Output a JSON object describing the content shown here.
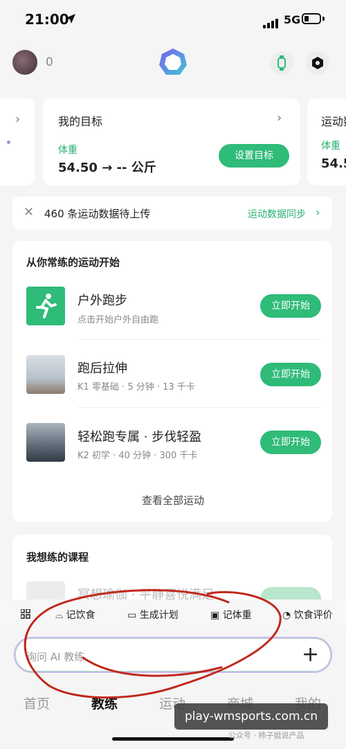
{
  "status_bar": {
    "time": "21:00",
    "network": "5G"
  },
  "header": {
    "coin_count": "0"
  },
  "goal_card": {
    "title": "我的目标",
    "label": "体重",
    "value": "54.50 → -- 公斤",
    "button": "设置目标"
  },
  "right_card": {
    "title": "运动数",
    "label": "体重",
    "value": "54.5"
  },
  "upload_banner": {
    "text": "460 条运动数据待上传",
    "link": "运动数据同步"
  },
  "workouts": {
    "title": "从你常练的运动开始",
    "items": [
      {
        "name": "户外跑步",
        "sub": "点击开始户外自由跑",
        "button": "立即开始"
      },
      {
        "name": "跑后拉伸",
        "sub": "K1 零基础 · 5 分钟 · 13 千卡",
        "button": "立即开始"
      },
      {
        "name": "轻松跑专属 · 步伐轻盈",
        "sub": "K2 初学 · 40 分钟 · 300 千卡",
        "button": "立即开始"
      }
    ],
    "view_all": "查看全部运动"
  },
  "courses": {
    "title": "我想练的课程",
    "item": "冥想瑜伽 · 平静喜悦满足"
  },
  "quick_actions": [
    "记饮食",
    "生成计划",
    "记体重",
    "饮食评价"
  ],
  "ai_input": {
    "placeholder": "询问 AI 教练"
  },
  "tabs": [
    "首页",
    "教练",
    "运动",
    "商城",
    "我的"
  ],
  "active_tab": "教练",
  "watermark": {
    "text": "play-wmsports.com.cn",
    "sub": "公众号 · 柿子姐说产品"
  },
  "colors": {
    "accent": "#2fbb78",
    "annotation": "#c0281c"
  }
}
